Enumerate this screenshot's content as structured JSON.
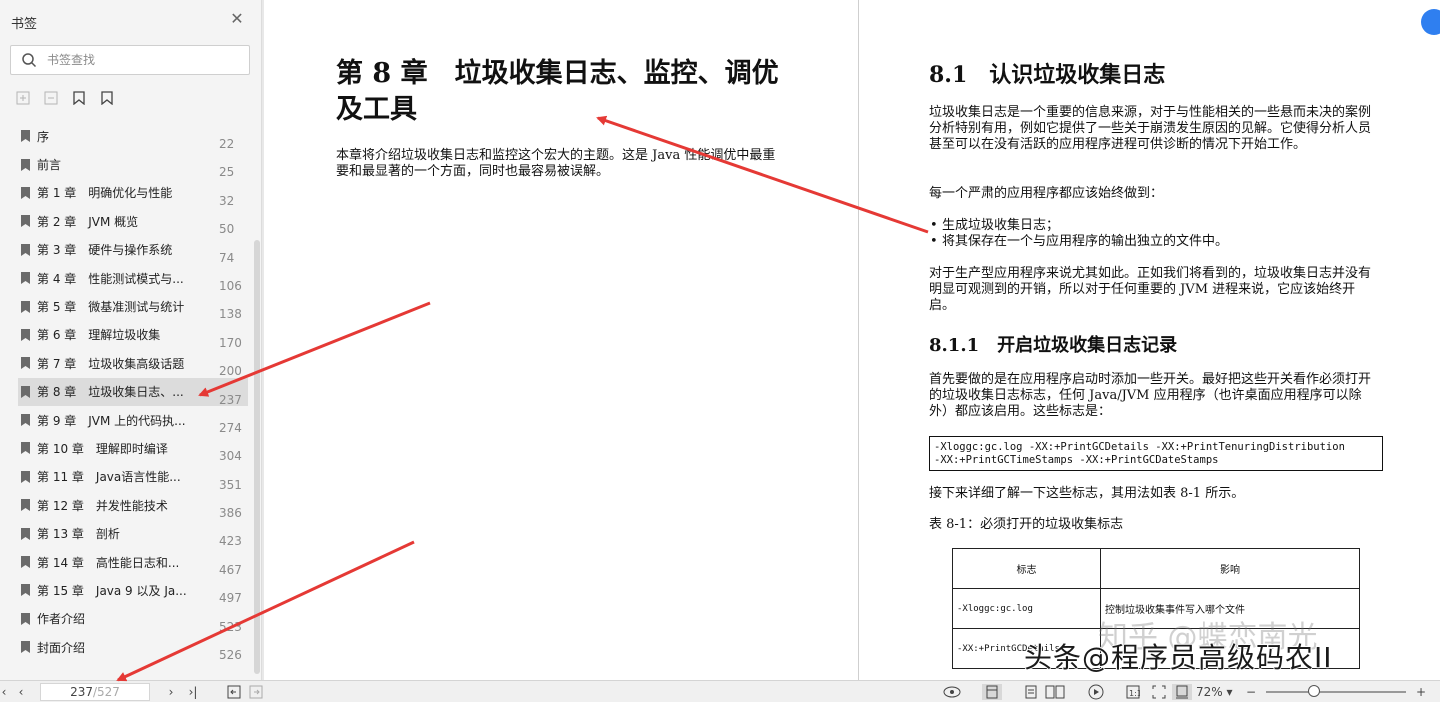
{
  "sidebar": {
    "title": "书签",
    "search_placeholder": "书签查找",
    "items": [
      {
        "label": "序",
        "page": "22"
      },
      {
        "label": "前言",
        "page": "25"
      },
      {
        "label": "第 1 章　明确优化与性能",
        "page": "32"
      },
      {
        "label": "第 2 章　JVM 概览",
        "page": "50"
      },
      {
        "label": "第 3 章　硬件与操作系统",
        "page": "74"
      },
      {
        "label": "第 4 章　性能测试模式与...",
        "page": "106"
      },
      {
        "label": "第 5 章　微基准测试与统计",
        "page": "138"
      },
      {
        "label": "第 6 章　理解垃圾收集",
        "page": "170"
      },
      {
        "label": "第 7 章　垃圾收集高级话题",
        "page": "200"
      },
      {
        "label": "第 8 章　垃圾收集日志、...",
        "page": "237"
      },
      {
        "label": "第 9 章　JVM 上的代码执...",
        "page": "274"
      },
      {
        "label": "第 10 章　理解即时编译",
        "page": "304"
      },
      {
        "label": "第 11 章　Java语言性能...",
        "page": "351"
      },
      {
        "label": "第 12 章　并发性能技术",
        "page": "386"
      },
      {
        "label": "第 13 章　剖析",
        "page": "423"
      },
      {
        "label": "第 14 章　高性能日志和...",
        "page": "467"
      },
      {
        "label": "第 15 章　Java 9 以及 Ja...",
        "page": "497"
      },
      {
        "label": "作者介绍",
        "page": "523"
      },
      {
        "label": "封面介绍",
        "page": "526"
      }
    ],
    "active_index": 9
  },
  "left_page": {
    "chapter_title": "第 8 章　垃圾收集日志、监控、调优及工具",
    "intro": "本章将介绍垃圾收集日志和监控这个宏大的主题。这是 Java 性能调优中最重要和最显著的一个方面，同时也最容易被误解。"
  },
  "right_page": {
    "section_title": "8.1　认识垃圾收集日志",
    "p1": "垃圾收集日志是一个重要的信息来源，对于与性能相关的一些悬而未决的案例分析特别有用，例如它提供了一些关于崩溃发生原因的见解。它使得分析人员甚至可以在没有活跃的应用程序进程可供诊断的情况下开始工作。",
    "p2": "每一个严肃的应用程序都应该始终做到：",
    "bullets": [
      "生成垃圾收集日志；",
      "将其保存在一个与应用程序的输出独立的文件中。"
    ],
    "p3": "对于生产型应用程序来说尤其如此。正如我们将看到的，垃圾收集日志并没有明显可观测到的开销，所以对于任何重要的 JVM 进程来说，它应该始终开启。",
    "subsection_title": "8.1.1　开启垃圾收集日志记录",
    "p4": "首先要做的是在应用程序启动时添加一些开关。最好把这些开关看作必须打开的垃圾收集日志标志，任何 Java/JVM 应用程序（也许桌面应用程序可以除外）都应该启用。这些标志是：",
    "code_line1": "-Xloggc:gc.log -XX:+PrintGCDetails -XX:+PrintTenuringDistribution",
    "code_line2": "-XX:+PrintGCTimeStamps -XX:+PrintGCDateStamps",
    "p5": "接下来详细了解一下这些标志，其用法如表 8-1 所示。",
    "table_caption": "表 8-1：必须打开的垃圾收集标志",
    "table_headers": [
      "标志",
      "影响"
    ],
    "table_rows": [
      [
        "-Xloggc:gc.log",
        "控制垃圾收集事件写入哪个文件"
      ],
      [
        "-XX:+PrintGCDetails",
        ""
      ]
    ]
  },
  "overlay": {
    "watermark": "头条@程序员高级码农II",
    "zhihu_mark": "知乎 @蝶恋南光"
  },
  "toolbar": {
    "current_page": "237",
    "total_pages": "/527",
    "zoom": "72%"
  },
  "colors": {
    "arrow": "#e53935",
    "accent": "#2f7ff0"
  }
}
